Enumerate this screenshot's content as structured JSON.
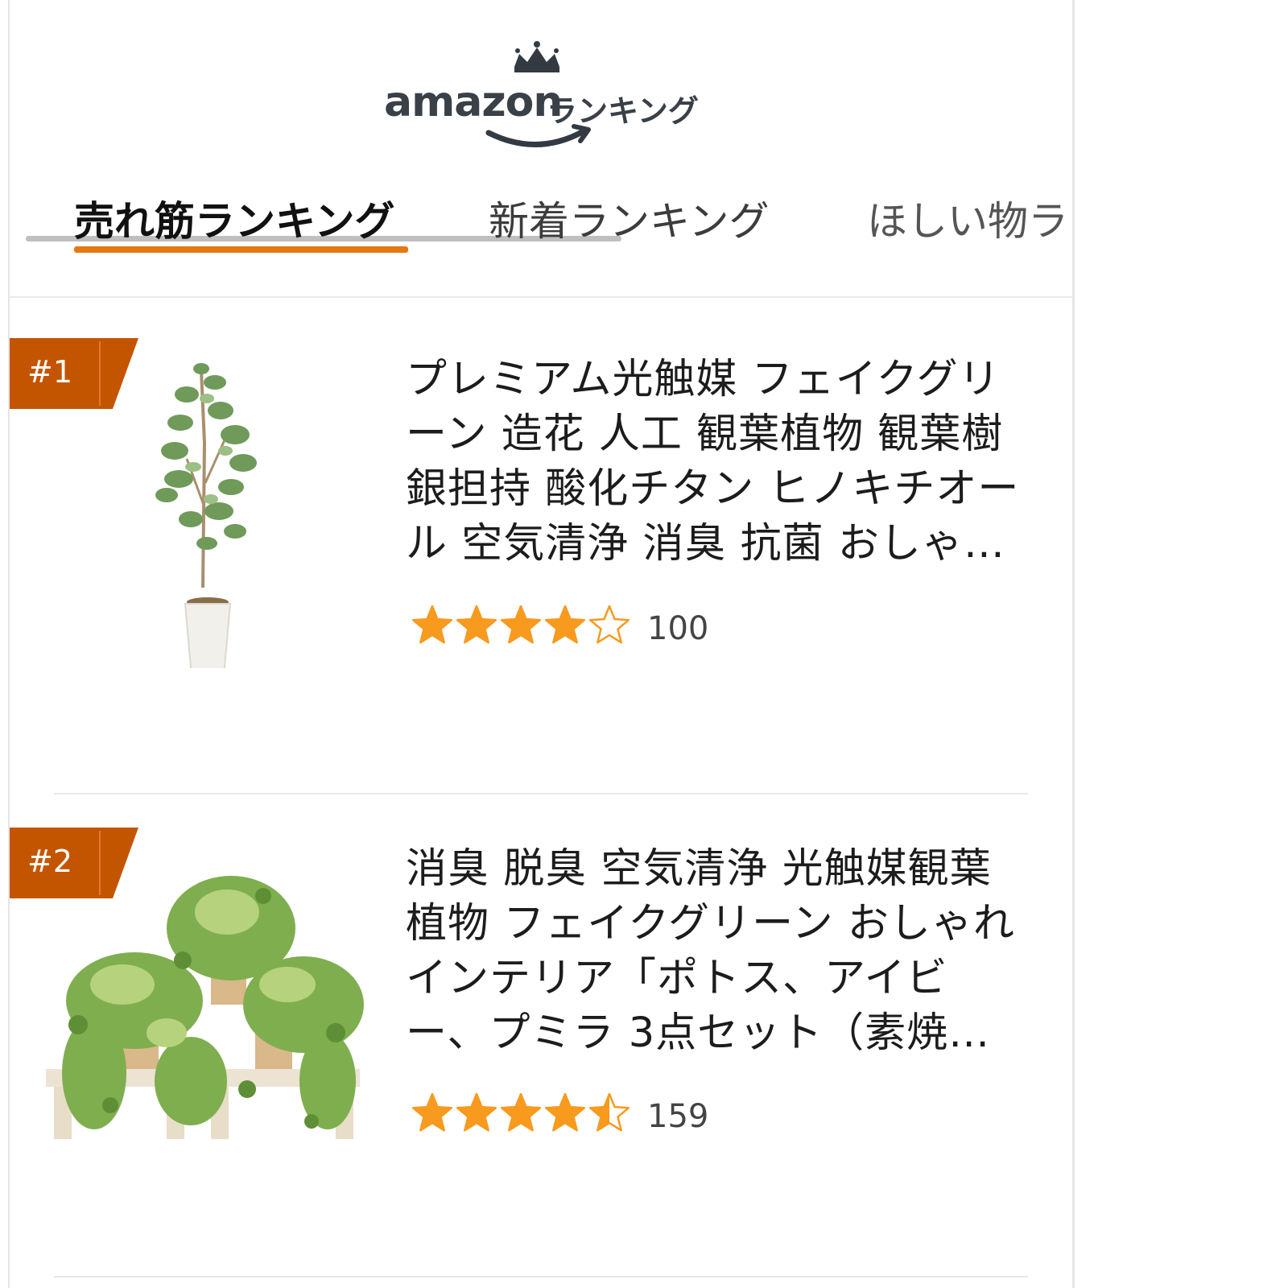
{
  "logo": {
    "brand": "amazon",
    "subtitle": "ランキング"
  },
  "tabs": [
    {
      "label": "売れ筋ランキング",
      "active": true
    },
    {
      "label": "新着ランキング",
      "active": false
    },
    {
      "label": "ほしい物ラ",
      "active": false
    }
  ],
  "items": [
    {
      "rank": "#1",
      "title_lines": [
        "プレミアム光触媒 フェイクグリ",
        "ーン 造花 人工 観葉植物 観葉樹",
        "銀担持 酸化チタン ヒノキチオー",
        "ル 空気清浄 消臭 抗菌 おしゃ…"
      ],
      "rating": 4.0,
      "review_count": "100",
      "image_icon": "potted-tree-icon"
    },
    {
      "rank": "#2",
      "title_lines": [
        "消臭 脱臭 空気清浄 光触媒観葉",
        "植物 フェイクグリーン おしゃれ",
        "インテリア「ポトス、アイビ",
        "ー、プミラ 3点セット（素焼…"
      ],
      "rating": 4.5,
      "review_count": "159",
      "image_icon": "hanging-plants-set-icon"
    }
  ],
  "colors": {
    "accent": "#e47911",
    "badge": "#c45500",
    "star": "#f79a1e",
    "text": "#1c1c1c"
  }
}
